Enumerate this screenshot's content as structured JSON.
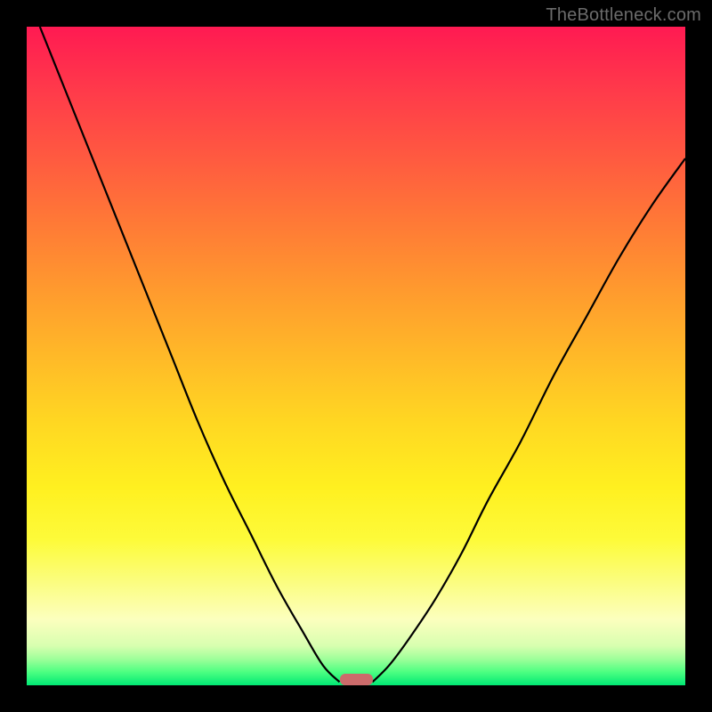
{
  "watermark": "TheBottleneck.com",
  "chart_data": {
    "type": "line",
    "title": "",
    "xlabel": "",
    "ylabel": "",
    "xlim": [
      0,
      100
    ],
    "ylim": [
      0,
      100
    ],
    "grid": false,
    "series": [
      {
        "name": "left-curve",
        "x": [
          2,
          6,
          10,
          14,
          18,
          22,
          26,
          30,
          34,
          38,
          42,
          45,
          47.5
        ],
        "y": [
          100,
          90,
          80,
          70,
          60,
          50,
          40,
          31,
          23,
          15,
          8,
          3,
          0.5
        ]
      },
      {
        "name": "right-curve",
        "x": [
          52.5,
          55,
          58,
          62,
          66,
          70,
          75,
          80,
          85,
          90,
          95,
          100
        ],
        "y": [
          0.5,
          3,
          7,
          13,
          20,
          28,
          37,
          47,
          56,
          65,
          73,
          80
        ]
      }
    ],
    "marker": {
      "x_center": 50,
      "width_pct": 5,
      "height_pct": 1.8,
      "color": "#cc6b6b"
    },
    "background_gradient": {
      "stops": [
        {
          "pos": 0,
          "color": "#ff1a52"
        },
        {
          "pos": 50,
          "color": "#ffb928"
        },
        {
          "pos": 78,
          "color": "#fdfb3a"
        },
        {
          "pos": 100,
          "color": "#00e874"
        }
      ]
    }
  }
}
